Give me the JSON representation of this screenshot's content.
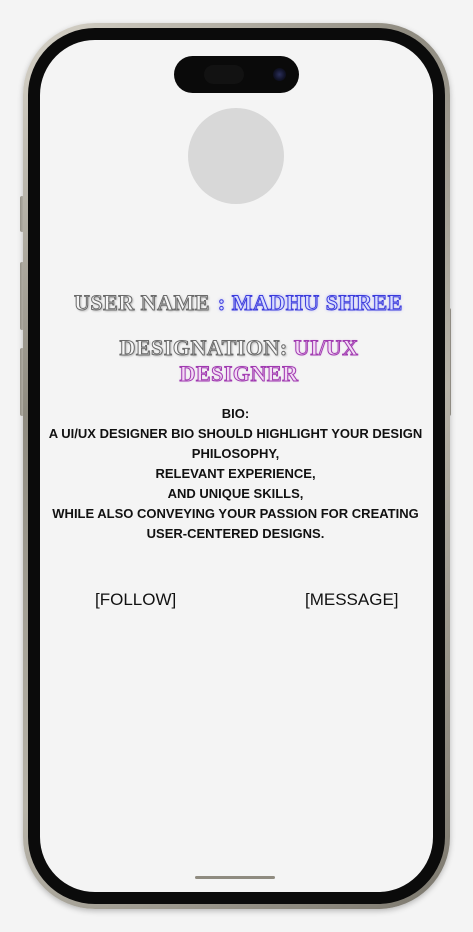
{
  "profile": {
    "username_label": "USER NAME",
    "username_value": ": MADHU SHREE",
    "designation_label": "DESIGNATION:",
    "designation_value_line1": "UI/UX",
    "designation_value_line2": "DESIGNER"
  },
  "bio": {
    "heading": "BIO:",
    "lines": [
      "A UI/UX DESIGNER BIO SHOULD HIGHLIGHT YOUR DESIGN",
      "PHILOSOPHY,",
      "RELEVANT EXPERIENCE,",
      "AND UNIQUE SKILLS,",
      "WHILE ALSO CONVEYING YOUR PASSION FOR CREATING",
      "USER-CENTERED DESIGNS."
    ]
  },
  "actions": {
    "follow_label": "[FOLLOW]",
    "message_label": "[MESSAGE]"
  },
  "colors": {
    "username_accent": "#3b3bdc",
    "designation_accent": "#a03ab0",
    "avatar_placeholder": "#d8d8d8",
    "screen_background": "#f4f4f4"
  }
}
